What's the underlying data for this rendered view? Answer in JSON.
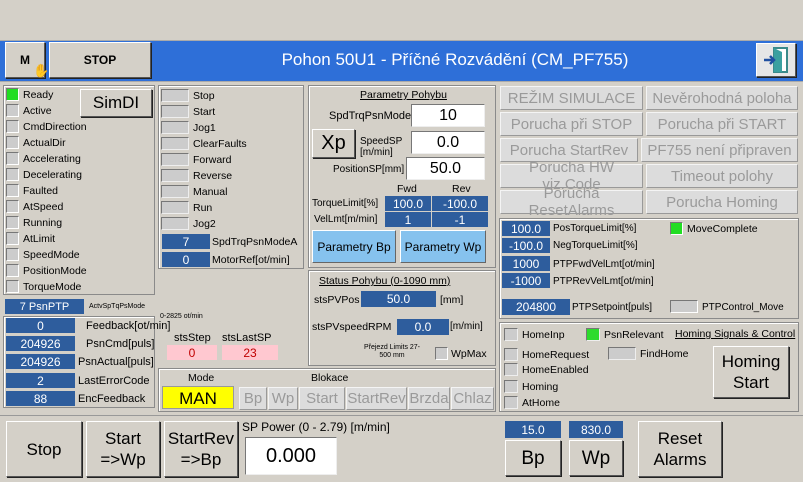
{
  "header": {
    "m_label": "M",
    "stop_label": "STOP",
    "title": "Pohon 50U1 - Příčné Rozvádění (CM_PF755)"
  },
  "status_signals": [
    "Ready",
    "Active",
    "CmdDirection",
    "ActualDir",
    "Accelerating",
    "Decelerating",
    "Faulted",
    "AtSpeed",
    "Running",
    "AtLimit",
    "SpeedMode",
    "PositionMode",
    "TorqueMode"
  ],
  "simdi_label": "SimDI",
  "psn_ptp_label": "7 PsnPTP",
  "actv_label": "ActvSpTqPsMode",
  "feedback": [
    {
      "value": "0",
      "label": "Feedback[ot/min]"
    },
    {
      "value": "204926",
      "label": "PsnCmd[puls]"
    },
    {
      "value": "204926",
      "label": "PsnActual[puls]"
    },
    {
      "value": "2",
      "label": "LastErrorCode"
    },
    {
      "value": "88",
      "label": "EncFeedback"
    }
  ],
  "commands": [
    "Stop",
    "Start",
    "Jog1",
    "ClearFaults",
    "Forward",
    "Reverse",
    "Manual",
    "Run",
    "Jog2"
  ],
  "spd_mode": {
    "value": "7",
    "label": "SpdTrqPsnModeA"
  },
  "motor_ref": {
    "value": "0",
    "label": "MotorRef[ot/min]"
  },
  "rpm_note": "0-2825 ot/min",
  "sts_step": {
    "label": "stsStep",
    "value": "0"
  },
  "sts_last": {
    "label": "stsLastSP",
    "value": "23"
  },
  "params": {
    "title": "Parametry Pohybu",
    "spd_label": "SpdTrqPsnMode",
    "spd_value": "10",
    "xp": "Xp",
    "speed_label": "SpeedSP [m/min]",
    "speed_value": "0.0",
    "pos_label": "PositionSP[mm]",
    "pos_value": "50.0",
    "fwd": "Fwd",
    "rev": "Rev",
    "torque_label": "TorqueLimit[%]",
    "torque_fwd": "100.0",
    "torque_rev": "-100.0",
    "vel_label": "VelLmt[m/min]",
    "vel_fwd": "1",
    "vel_rev": "-1",
    "pbp": "Parametry Bp",
    "pwp": "Parametry Wp"
  },
  "status": {
    "title": "Status Pohybu (0-1090 mm)",
    "pos_label": "stsPVPos",
    "pos_value": "50.0",
    "pos_unit": "[mm]",
    "rpm_label": "stsPVspeedRPM",
    "rpm_value": "0.0",
    "rpm_unit": "[m/min]",
    "prejezd": "Přejezd Limits 27-500 mm",
    "wpmax": "WpMax"
  },
  "mode": {
    "label": "Mode",
    "value": "MAN",
    "blokace": "Blokace",
    "items": [
      "Bp",
      "Wp",
      "Start",
      "StartRev",
      "Brzda",
      "Chlaz"
    ]
  },
  "sim_buttons": [
    "REŽIM SIMULACE",
    "Nevěrohodná poloha",
    "Porucha při STOP",
    "Porucha při START",
    "Porucha StartRev",
    "PF755 není připraven",
    "Porucha HW viz.Code",
    "Timeout polohy",
    "Porucha ResetAlarms",
    "Porucha Homing"
  ],
  "ptp": {
    "rows": [
      {
        "value": "100.0",
        "label": "PosTorqueLimit[%]"
      },
      {
        "value": "-100.0",
        "label": "NegTorqueLimit[%]"
      },
      {
        "value": "1000",
        "label": "PTPFwdVelLmt[ot/min]"
      },
      {
        "value": "-1000",
        "label": "PTPRevVelLmt[ot/min]"
      }
    ],
    "move_complete": "MoveComplete",
    "setpoint_value": "204800",
    "setpoint_label": "PTPSetpoint[puls]",
    "control_move": "PTPControl_Move"
  },
  "homing": {
    "title": "Homing Signals & Control",
    "signals": [
      "HomeInp",
      "HomeRequest",
      "HomeEnabled",
      "Homing",
      "AtHome"
    ],
    "psn_relevant": "PsnRelevant",
    "find_home": "FindHome",
    "homing_start": "Homing Start"
  },
  "bottom": {
    "stop": "Stop",
    "start_wp": "Start =>Wp",
    "startrev_bp": "StartRev =>Bp",
    "sp_power_label": "SP Power (0 - 2.79) [m/min]",
    "sp_power_value": "0.000",
    "bp_value": "15.0",
    "bp_label": "Bp",
    "wp_value": "830.0",
    "wp_label": "Wp",
    "reset": "Reset Alarms"
  },
  "colors": {
    "header": "#2e6fd8",
    "value_blue": "#2e5d9d",
    "green": "#22dd22",
    "yellow": "#ffff00"
  }
}
